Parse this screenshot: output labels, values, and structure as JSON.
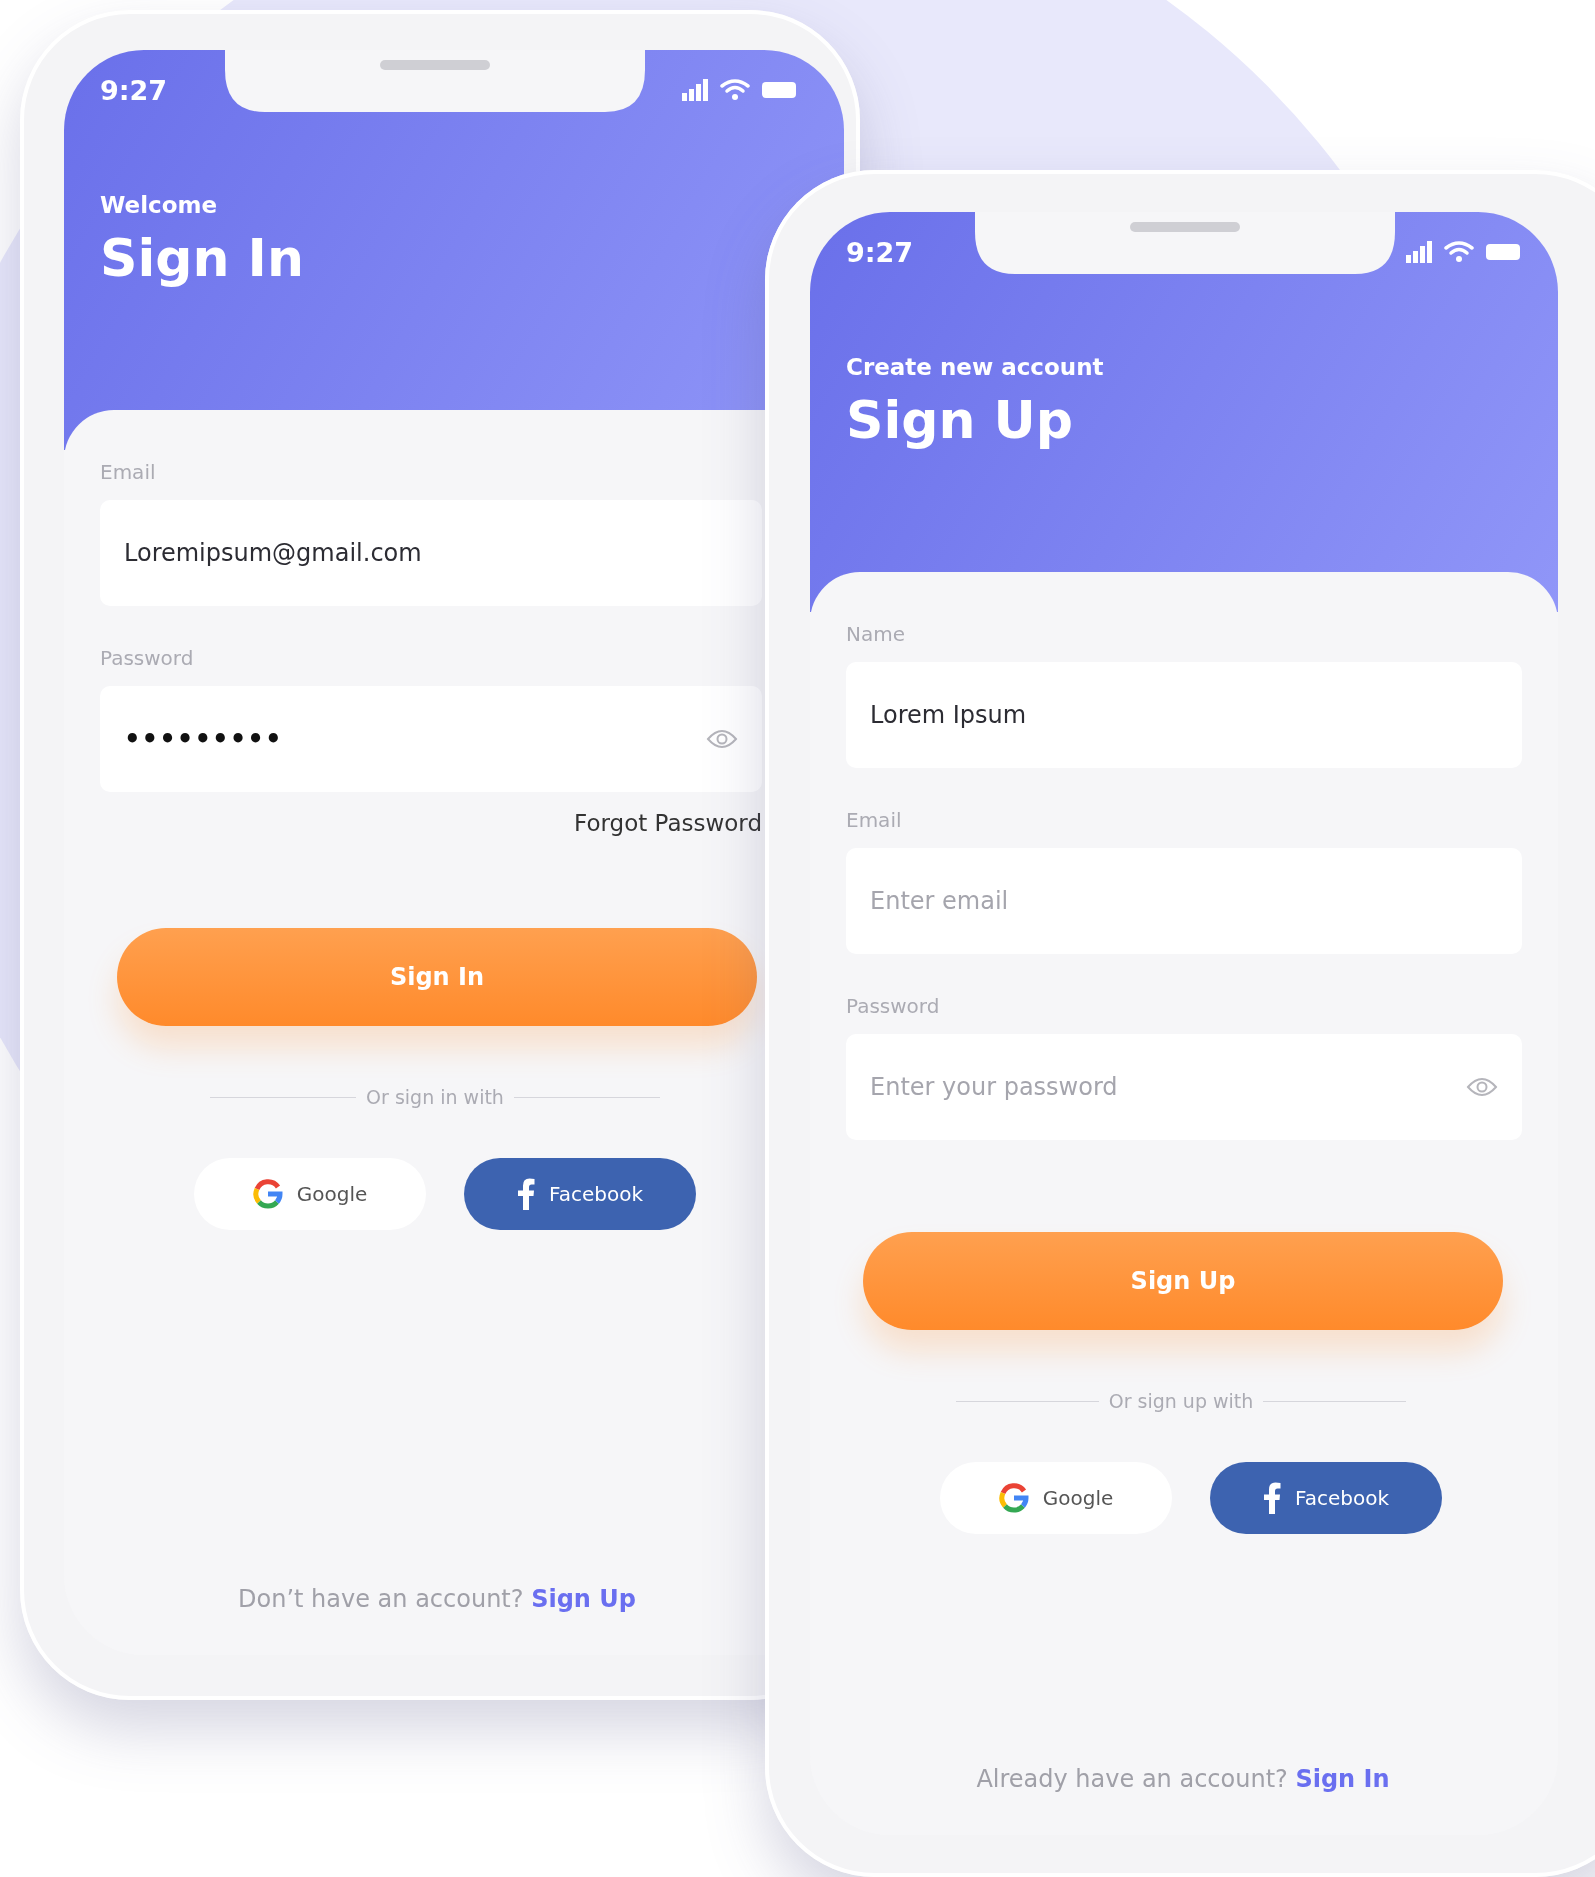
{
  "screens": [
    {
      "time": "9:27",
      "subtitle": "Welcome",
      "title": "Sign In",
      "fields": [
        {
          "label": "Email",
          "kind": "text",
          "value": "Loremipsum@gmail.com"
        },
        {
          "label": "Password",
          "kind": "password",
          "value": "•••••••••"
        }
      ],
      "forgot_link": "Forgot Password",
      "primary_button": "Sign In",
      "divider_text": "Or sign in with",
      "social_buttons": [
        {
          "label": "Google",
          "kind": "google"
        },
        {
          "label": "Facebook",
          "kind": "facebook"
        }
      ],
      "footer": {
        "text": "Don’t have an account?",
        "link": "Sign Up"
      }
    },
    {
      "time": "9:27",
      "subtitle": "Create new account",
      "title": "Sign Up",
      "fields": [
        {
          "label": "Name",
          "kind": "text",
          "value": "Lorem Ipsum"
        },
        {
          "label": "Email",
          "kind": "text",
          "placeholder": "Enter email"
        },
        {
          "label": "Password",
          "kind": "password",
          "placeholder": "Enter your password"
        }
      ],
      "primary_button": "Sign Up",
      "divider_text": "Or sign up with",
      "social_buttons": [
        {
          "label": "Google",
          "kind": "google"
        },
        {
          "label": "Facebook",
          "kind": "facebook"
        }
      ],
      "footer": {
        "text": "Already have an account?",
        "link": "Sign In"
      }
    }
  ]
}
